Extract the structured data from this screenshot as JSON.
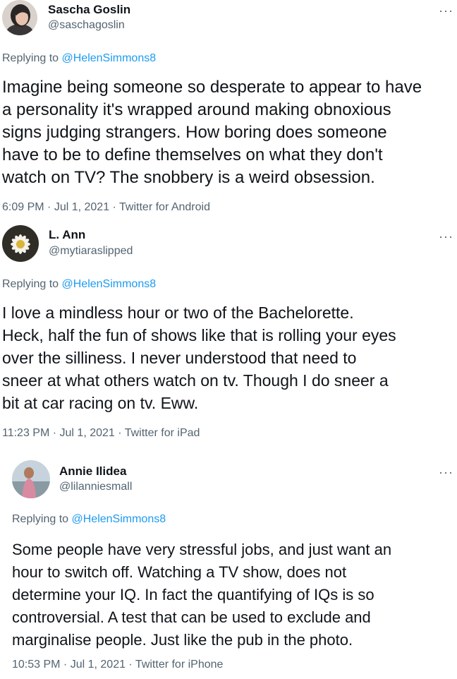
{
  "tweets": [
    {
      "name": "Sascha Goslin",
      "handle": "@saschagoslin",
      "more_icon": "more-horizontal-icon",
      "reply_prefix": "Replying to ",
      "reply_to": "@HelenSimmons8",
      "text": "Imagine being someone so desperate to appear to have\na personality it's wrapped around making obnoxious\nsigns judging strangers. How boring does someone\nhave to be to define themselves on what they don't\nwatch on TV? The snobbery is a weird obsession.",
      "time": "6:09 PM",
      "date": "Jul 1, 2021",
      "source": "Twitter for Android"
    },
    {
      "name": "L. Ann",
      "handle": "@mytiaraslipped",
      "more_icon": "more-horizontal-icon",
      "reply_prefix": "Replying to ",
      "reply_to": "@HelenSimmons8",
      "text": "I love a mindless hour or two of the Bachelorette.\nHeck, half the fun of shows like that is rolling your eyes\nover the silliness. I never understood that need to\nsneer at what others watch on tv.   Though I do sneer a\nbit at car racing on tv.  Eww.",
      "time": "11:23 PM",
      "date": "Jul 1, 2021",
      "source": "Twitter for iPad"
    },
    {
      "name": "Annie Ilidea",
      "handle": "@lilanniesmall",
      "more_icon": "more-horizontal-icon",
      "reply_prefix": "Replying to ",
      "reply_to": "@HelenSimmons8",
      "text": "Some people have very stressful jobs, and just want an\nhour to switch off. Watching a TV show, does not\ndetermine your IQ. In fact the quantifying of IQs is so\ncontroversial. A test that can be used to exclude and\nmarginalise people. Just like the pub in the photo.",
      "time": "10:53 PM",
      "date": "Jul 1, 2021",
      "source": "Twitter for iPhone"
    }
  ],
  "separator": " · ",
  "colors": {
    "link": "#1d9bf0",
    "secondary": "#536471",
    "text": "#0f1419"
  }
}
